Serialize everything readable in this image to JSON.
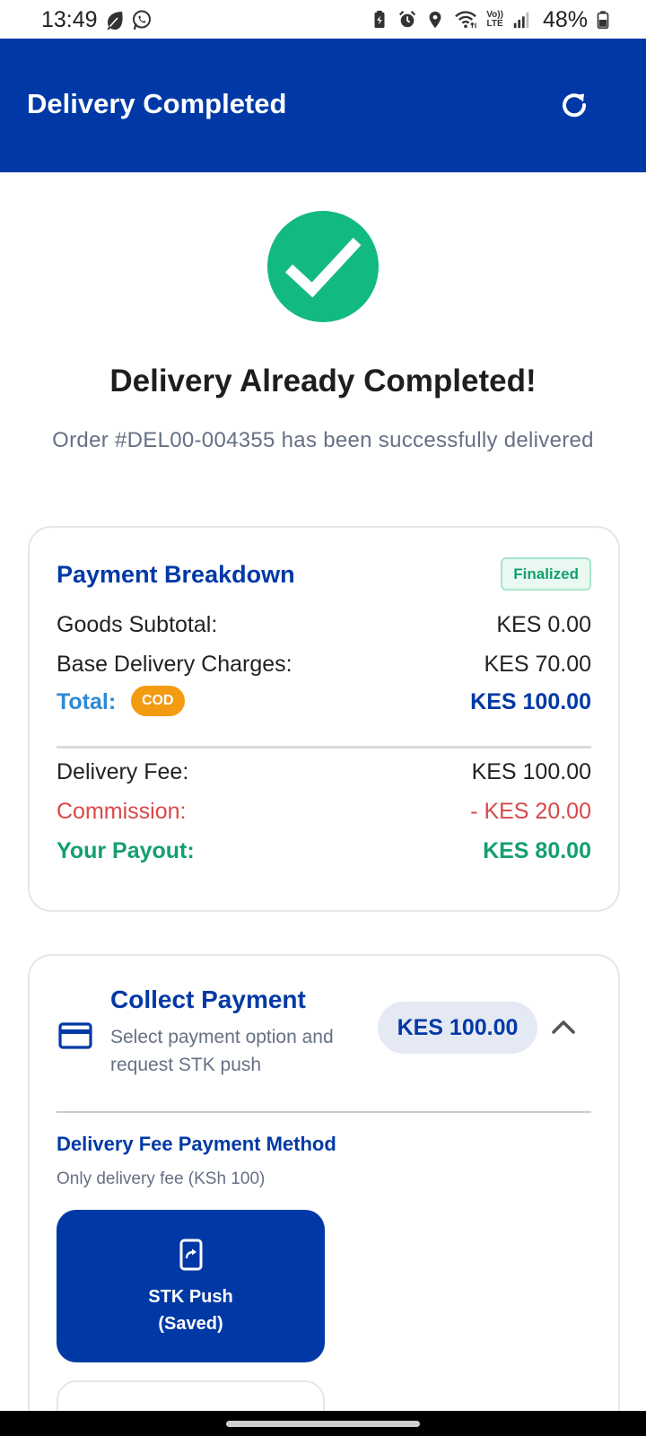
{
  "status_bar": {
    "time": "13:49",
    "network": "Vo)) LTE",
    "battery": "48%",
    "left_icons": [
      "leaf-icon",
      "whatsapp-icon"
    ],
    "right_icons": [
      "battery-saver-icon",
      "alarm-icon",
      "location-icon",
      "wifi-icon",
      "volte-icon",
      "signal-icon",
      "battery-icon"
    ]
  },
  "app_bar": {
    "title": "Delivery Completed",
    "action_icon": "refresh-icon",
    "color": "#0039a6"
  },
  "success": {
    "icon": "check-circle-icon",
    "icon_color": "#13b982",
    "title": "Delivery Already Completed!",
    "message": "Order #DEL00-004355 has been successfully delivered"
  },
  "breakdown": {
    "title": "Payment Breakdown",
    "status_badge": "Finalized",
    "goods_subtotal_label": "Goods Subtotal:",
    "goods_subtotal_value": "KES 0.00",
    "base_delivery_label": "Base Delivery Charges:",
    "base_delivery_value": "KES 70.00",
    "total_label": "Total:",
    "total_badge": "COD",
    "total_value": "KES 100.00",
    "delivery_fee_label": "Delivery Fee:",
    "delivery_fee_value": "KES 100.00",
    "commission_label": "Commission:",
    "commission_value": "- KES 20.00",
    "payout_label": "Your Payout:",
    "payout_value": "KES 80.00"
  },
  "collect": {
    "icon": "credit-card-icon",
    "title": "Collect Payment",
    "subtitle": "Select payment option and request STK push",
    "amount": "KES 100.00",
    "toggle_icon": "chevron-up-icon",
    "method_title": "Delivery Fee Payment Method",
    "method_subtitle": "Only delivery fee (KSh 100)",
    "options": [
      {
        "icon": "phone-forward-icon",
        "line1": "STK Push",
        "line2": "(Saved)",
        "selected": true
      }
    ]
  }
}
